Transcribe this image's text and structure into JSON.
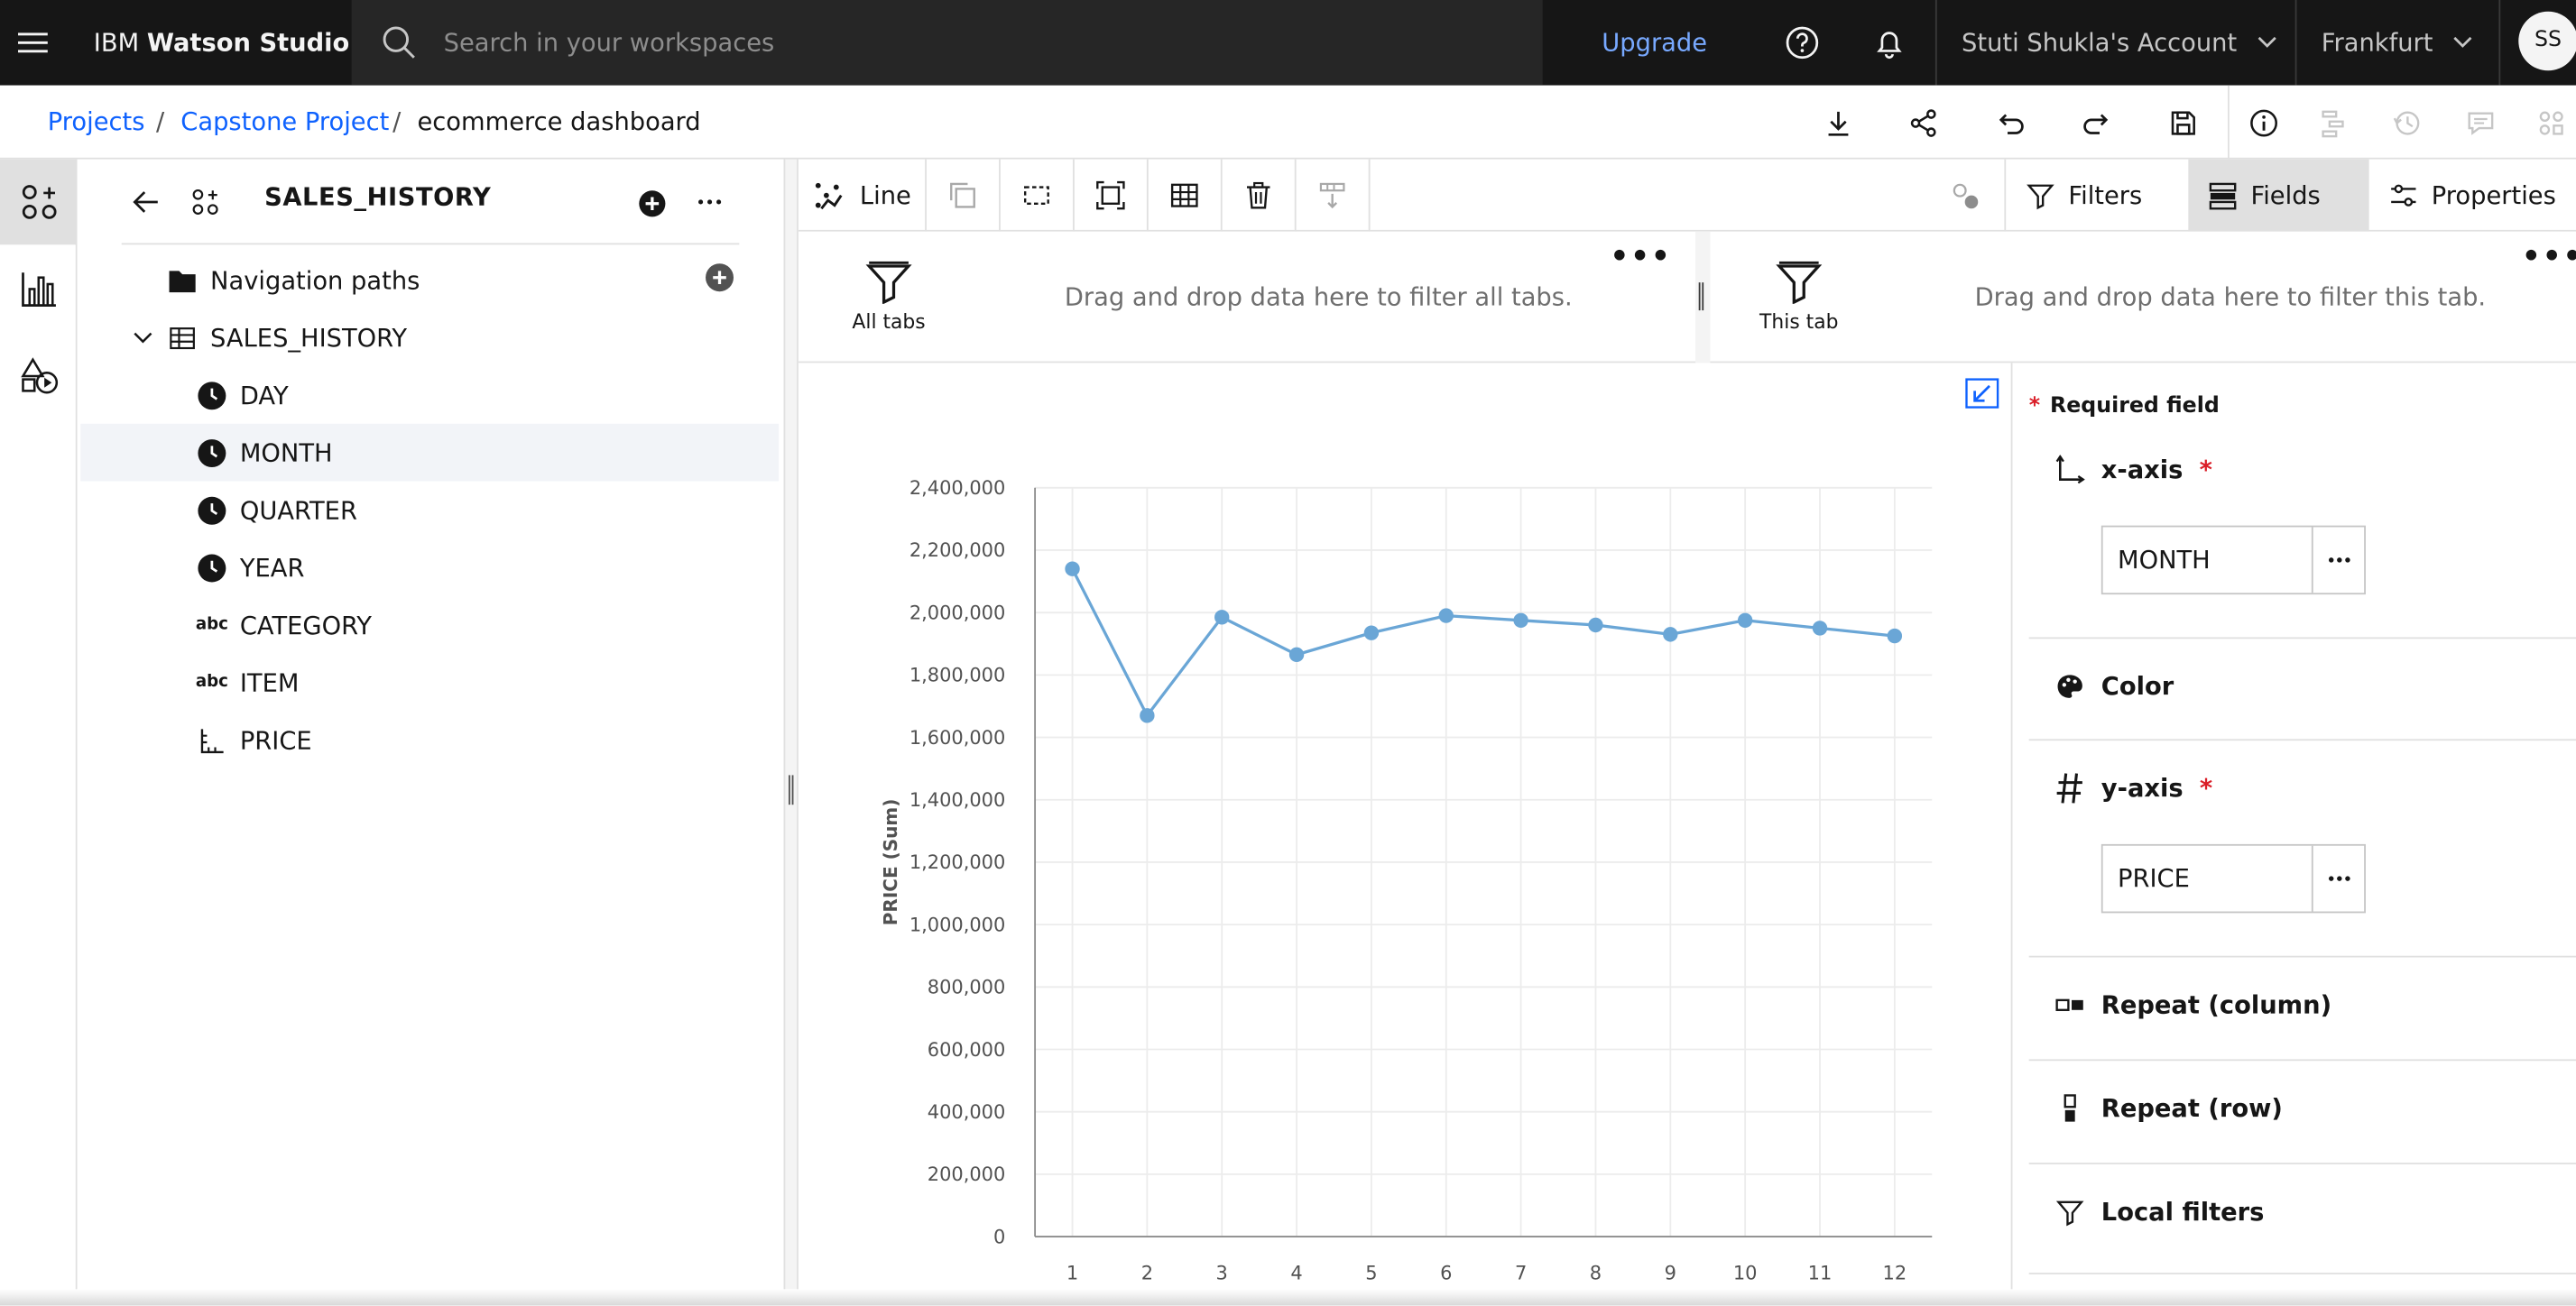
{
  "app": {
    "menu_icon": "hamburger-icon",
    "brand_prefix": "IBM",
    "brand_name": "Watson Studio"
  },
  "search": {
    "placeholder": "Search in your workspaces",
    "value": ""
  },
  "header": {
    "upgrade_label": "Upgrade",
    "account_label": "Stuti Shukla's Account",
    "region_label": "Frankfurt",
    "avatar_initials": "SS"
  },
  "breadcrumb": [
    {
      "label": "Projects"
    },
    {
      "label": "Capstone Project"
    },
    {
      "label": "ecommerce dashboard"
    }
  ],
  "breadcrumb_separator": "/",
  "data_panel": {
    "title": "SALES_HISTORY",
    "navigation_paths_label": "Navigation paths",
    "table_label": "SALES_HISTORY",
    "columns": [
      {
        "label": "DAY",
        "icon": "clock-icon"
      },
      {
        "label": "MONTH",
        "icon": "clock-icon",
        "selected": true
      },
      {
        "label": "QUARTER",
        "icon": "clock-icon"
      },
      {
        "label": "YEAR",
        "icon": "clock-icon"
      },
      {
        "label": "CATEGORY",
        "icon": "abc-icon"
      },
      {
        "label": "ITEM",
        "icon": "abc-icon"
      },
      {
        "label": "PRICE",
        "icon": "measure-icon"
      }
    ],
    "abc_text": "abc"
  },
  "toolbar": {
    "viz_type_label": "Line",
    "filters_label": "Filters",
    "fields_label": "Fields",
    "properties_label": "Properties"
  },
  "filters": {
    "all_tabs_label": "All tabs",
    "all_tabs_hint": "Drag and drop data here to filter all tabs.",
    "this_tab_label": "This tab",
    "this_tab_hint": "Drag and drop data here to filter this tab.",
    "more_label": "•••"
  },
  "fields_panel": {
    "required_label": "Required field",
    "required_star": "*",
    "x_axis_label": "x-axis",
    "x_axis_value": "MONTH",
    "color_label": "Color",
    "y_axis_label": "y-axis",
    "y_axis_value": "PRICE",
    "repeat_column_label": "Repeat (column)",
    "repeat_row_label": "Repeat (row)",
    "local_filters_label": "Local filters"
  },
  "colors": {
    "topbar": "#161616",
    "search": "#262626",
    "link": "#0f62fe",
    "upgrade": "#78a9ff",
    "line": "#6aa6d6",
    "required": "#da1e28"
  },
  "chart_data": {
    "type": "line",
    "ylabel": "PRICE (Sum)",
    "xlabel": "",
    "categories": [
      "1",
      "2",
      "3",
      "4",
      "5",
      "6",
      "7",
      "8",
      "9",
      "10",
      "11",
      "12"
    ],
    "series": [
      {
        "values": [
          2140000,
          1670000,
          1985000,
          1865000,
          1935000,
          1990000,
          1975000,
          1960000,
          1930000,
          1975000,
          1950000,
          1925000
        ]
      }
    ],
    "yticks": [
      "0",
      "200,000",
      "400,000",
      "600,000",
      "800,000",
      "1,000,000",
      "1,200,000",
      "1,400,000",
      "1,600,000",
      "1,800,000",
      "2,000,000",
      "2,200,000",
      "2,400,000"
    ],
    "ylim": [
      0,
      2400000
    ],
    "grid": true,
    "legend": "none"
  }
}
